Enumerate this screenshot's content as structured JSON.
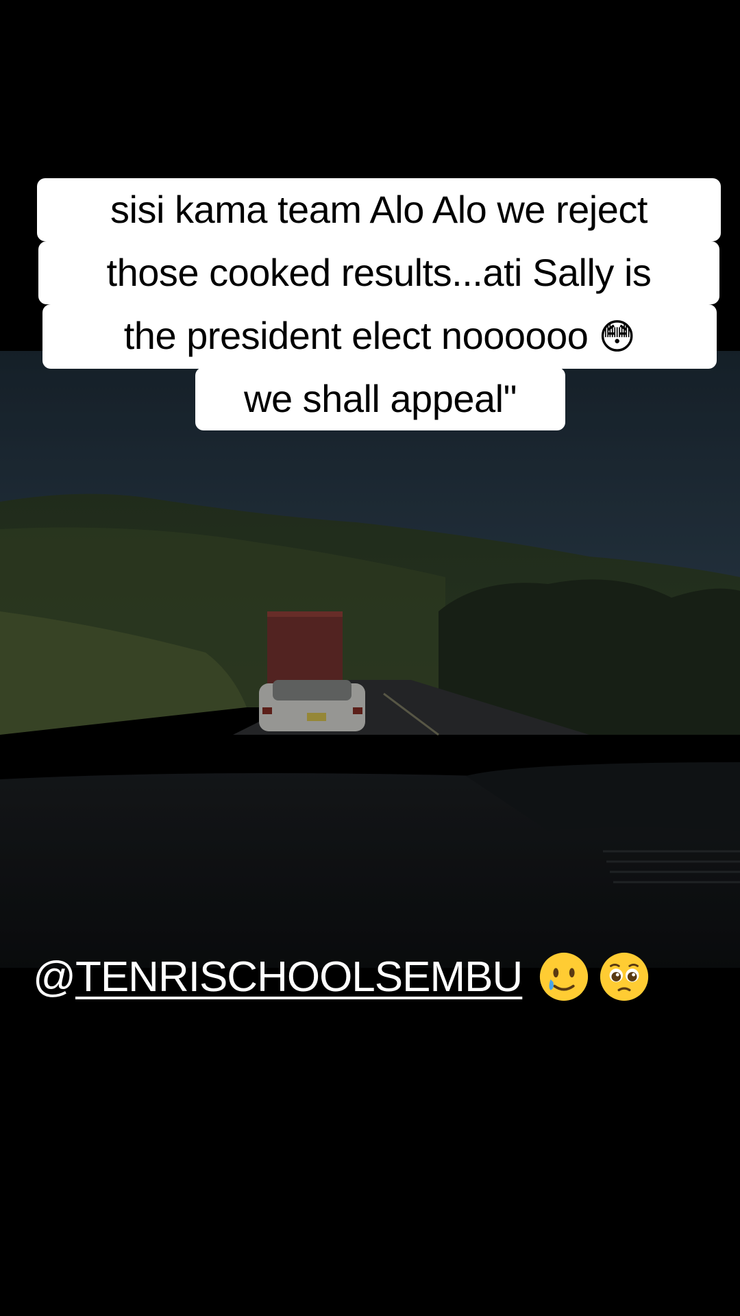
{
  "caption": {
    "lines": [
      "sisi kama team Alo Alo we reject",
      "those cooked results...ati Sally is",
      "the president elect noooooo",
      "we shall appeal\""
    ],
    "line3_emoji": "😳"
  },
  "mention": {
    "at": "@",
    "handle": "TENRISCHOOLSEMBU",
    "emojis": [
      "smiling-face-with-tear-icon",
      "pleading-face-icon"
    ]
  }
}
